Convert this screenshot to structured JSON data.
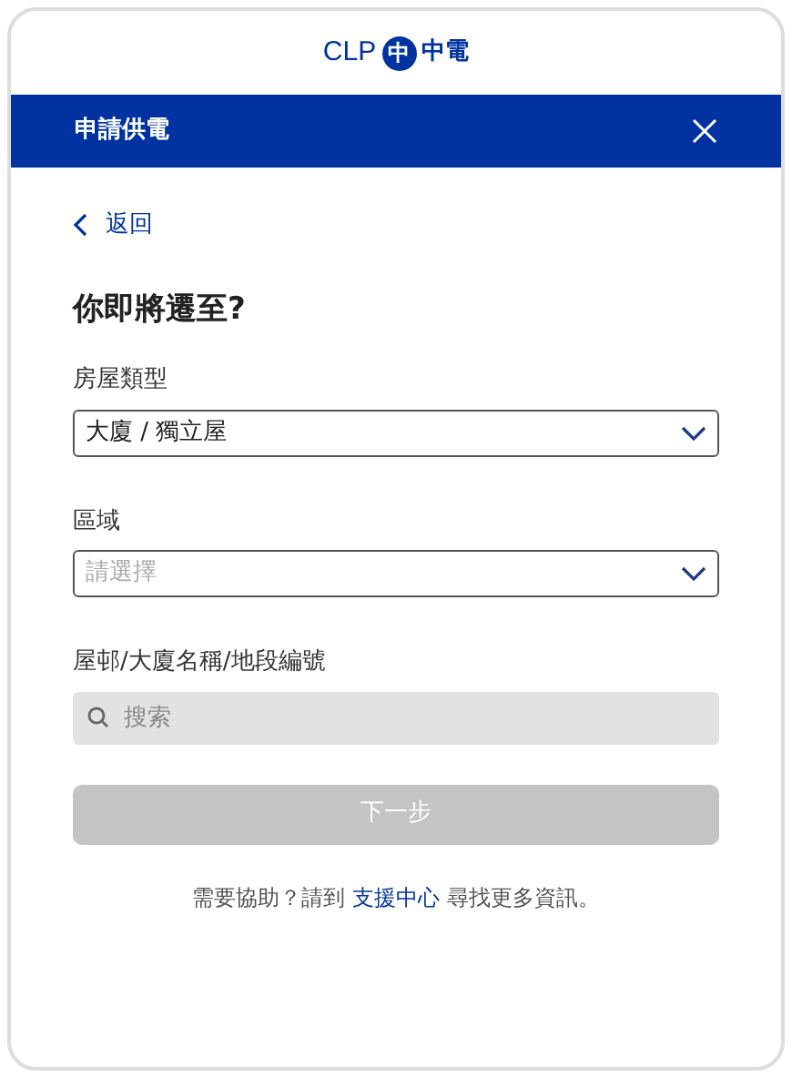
{
  "logo": {
    "text": "CLP",
    "emblem": "中",
    "name": "中電"
  },
  "title_bar": {
    "title": "申請供電"
  },
  "back_link": "返回",
  "heading": "你即將遷至?",
  "fields": [
    {
      "kind": "select",
      "label": "房屋類型",
      "value": "大廈 / 獨立屋"
    },
    {
      "kind": "select",
      "label": "區域",
      "placeholder": "請選擇"
    },
    {
      "kind": "search",
      "label": "屋邨/大廈名稱/地段編號",
      "placeholder": "搜索"
    }
  ],
  "next_button": {
    "label": "下一步",
    "disabled": true
  },
  "help": {
    "before": "需要協助？請到 ",
    "link": "支援中心",
    "after": " 尋找更多資訊。"
  }
}
